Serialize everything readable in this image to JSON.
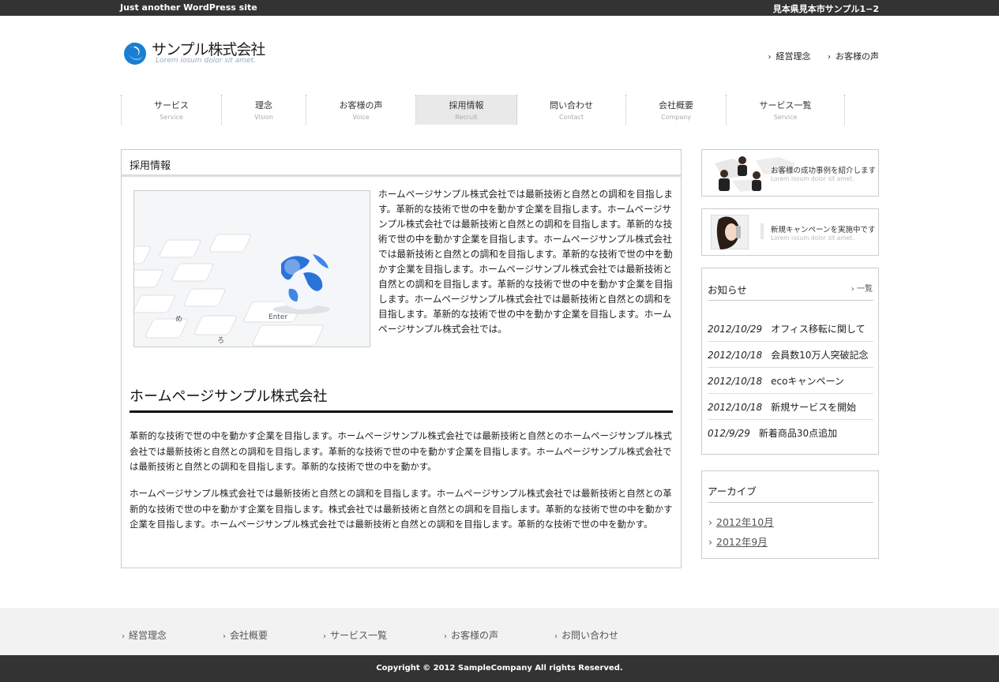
{
  "topbar": {
    "site_desc": "Just another WordPress site",
    "address": "見本県見本市サンプル1−2"
  },
  "logo": {
    "name": "サンプル株式会社",
    "tagline": "Lorem iosum dolor sit amet."
  },
  "header_links": [
    "経営理念",
    "お客様の声"
  ],
  "nav": [
    {
      "ja": "サービス",
      "en": "Service"
    },
    {
      "ja": "理念",
      "en": "Vision"
    },
    {
      "ja": "お客様の声",
      "en": "Voice"
    },
    {
      "ja": "採用情報",
      "en": "Recruit"
    },
    {
      "ja": "問い合わせ",
      "en": "Contact"
    },
    {
      "ja": "会社概要",
      "en": "Company"
    },
    {
      "ja": "サービス一覧",
      "en": "Service"
    }
  ],
  "main": {
    "title": "採用情報",
    "intro": "ホームページサンプル株式会社では最新技術と自然との調和を目指します。革新的な技術で世の中を動かす企業を目指します。ホームページサンプル株式会社では最新技術と自然との調和を目指します。革新的な技術で世の中を動かす企業を目指します。ホームページサンプル株式会社では最新技術と自然との調和を目指します。革新的な技術で世の中を動かす企業を目指します。ホームページサンプル株式会社では最新技術と自然との調和を目指します。革新的な技術で世の中を動かす企業を目指します。ホームページサンプル株式会社では最新技術と自然との調和を目指します。革新的な技術で世の中を動かす企業を目指します。ホームページサンプル株式会社では。",
    "heading": "ホームページサンプル株式会社",
    "para1": "革新的な技術で世の中を動かす企業を目指します。ホームページサンプル株式会社では最新技術と自然とのホームページサンプル株式会社では最新技術と自然との調和を目指します。革新的な技術で世の中を動かす企業を目指します。ホームページサンプル株式会社では最新技術と自然との調和を目指します。革新的な技術で世の中を動かす。",
    "para2": "ホームページサンプル株式会社では最新技術と自然との調和を目指します。ホームページサンプル株式会社では最新技術と自然との革新的な技術で世の中を動かす企業を目指します。株式会社では最新技術と自然との調和を目指します。革新的な技術で世の中を動かす企業を目指します。ホームページサンプル株式会社では最新技術と自然との調和を目指します。革新的な技術で世の中を動かす。",
    "image_keys": {
      "enter": "Enter",
      "me": "め",
      "ro": "ろ"
    }
  },
  "banners": [
    {
      "title": "お客様の成功事例を紹介します",
      "sub": "Lorem iosum dolor sit amet."
    },
    {
      "title": "新規キャンペーンを実施中です",
      "sub": "Lorem iosum dolor sit amet."
    }
  ],
  "news": {
    "heading": "お知らせ",
    "more": "一覧",
    "items": [
      {
        "date": "2012/10/29",
        "title": "オフィス移転に関して"
      },
      {
        "date": "2012/10/18",
        "title": "会員数10万人突破記念"
      },
      {
        "date": "2012/10/18",
        "title": "ecoキャンペーン"
      },
      {
        "date": "2012/10/18",
        "title": "新規サービスを開始"
      },
      {
        "date": "012/9/29",
        "title": "新着商品30点追加"
      }
    ]
  },
  "archive": {
    "heading": "アーカイブ",
    "items": [
      "2012年10月",
      "2012年9月"
    ]
  },
  "footer": {
    "links": [
      "経営理念",
      "会社概要",
      "サービス一覧",
      "お客様の声",
      "お問い合わせ"
    ],
    "copyright": "Copyright © 2012 SampleCompany All rights Reserved."
  },
  "colors": {
    "topbar": "#333333",
    "accent": "#1a7fd1",
    "nav_active": "#e9e9e9",
    "footer": "#f2f2f2"
  }
}
